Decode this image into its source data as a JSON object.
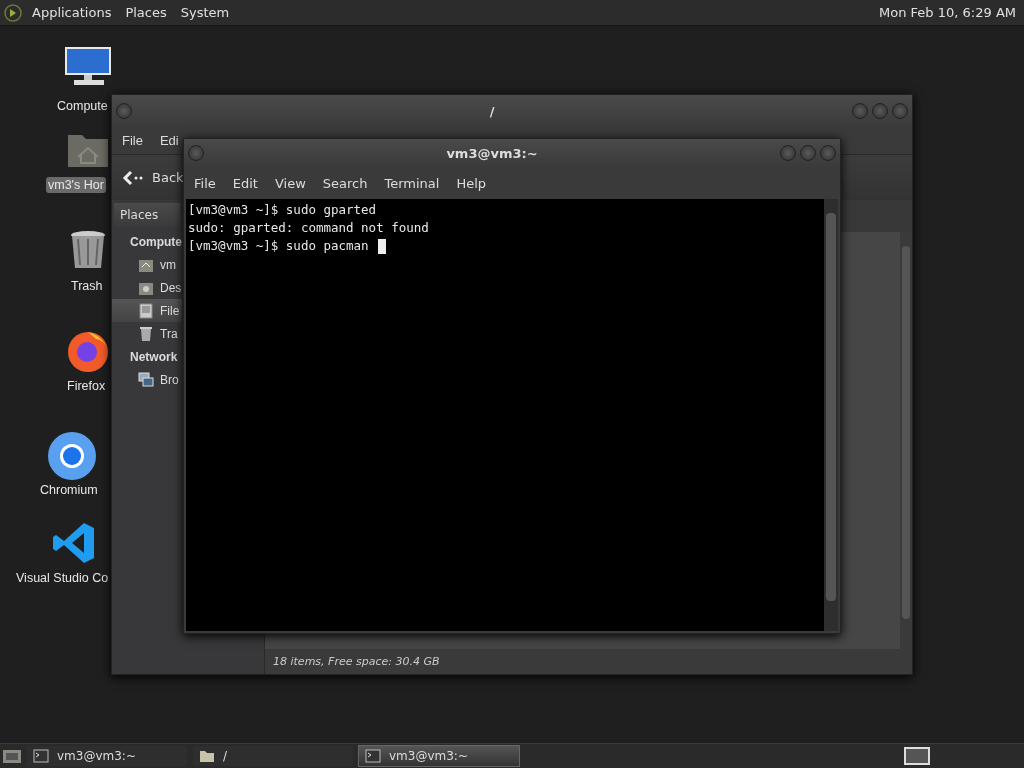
{
  "top_panel": {
    "menus": [
      "Applications",
      "Places",
      "System"
    ],
    "clock": "Mon Feb 10, 6:29 AM"
  },
  "desktop_icons": [
    {
      "kind": "computer",
      "label": "Compute",
      "selected": false
    },
    {
      "kind": "home-folder",
      "label": "vm3's Hor",
      "selected": true
    },
    {
      "kind": "trash",
      "label": "Trash",
      "selected": false
    },
    {
      "kind": "firefox",
      "label": "Firefox",
      "selected": false
    },
    {
      "kind": "chromium",
      "label": "Chromium",
      "selected": false
    },
    {
      "kind": "vscode",
      "label": "Visual Studio Co",
      "selected": false
    }
  ],
  "file_manager": {
    "title": "/",
    "menu": [
      "File",
      "Edi"
    ],
    "back_button": "Back",
    "sidebar_header": "Places",
    "sections": [
      {
        "label": "Compute",
        "items": [
          {
            "kind": "home",
            "label": "vm",
            "selected": false
          },
          {
            "kind": "desktop",
            "label": "Des",
            "selected": false
          },
          {
            "kind": "filesystem",
            "label": "File",
            "selected": true
          },
          {
            "kind": "trash",
            "label": "Tra",
            "selected": false
          }
        ]
      },
      {
        "label": "Network",
        "items": [
          {
            "kind": "network",
            "label": "Bro",
            "selected": false
          }
        ]
      }
    ],
    "status_bar": "18 items, Free space: 30.4 GB"
  },
  "terminal": {
    "title": "vm3@vm3:~",
    "menu": [
      "File",
      "Edit",
      "View",
      "Search",
      "Terminal",
      "Help"
    ],
    "lines": [
      "[vm3@vm3 ~]$ sudo gparted",
      "sudo: gparted: command not found",
      "[vm3@vm3 ~]$ sudo pacman "
    ]
  },
  "taskbar": {
    "tasks": [
      {
        "kind": "terminal",
        "label": "vm3@vm3:~",
        "selected": false
      },
      {
        "kind": "folder",
        "label": "/",
        "selected": false
      },
      {
        "kind": "terminal",
        "label": "vm3@vm3:~",
        "selected": true
      }
    ]
  }
}
